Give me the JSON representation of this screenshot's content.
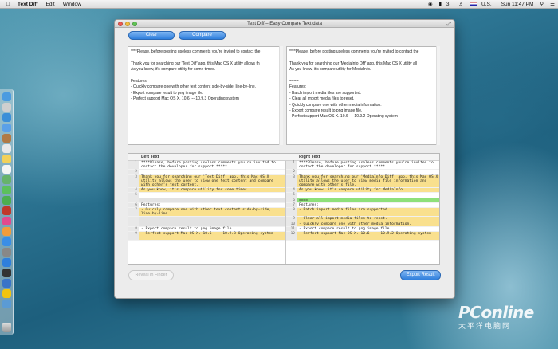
{
  "menubar": {
    "app_name": "Text Diff",
    "items": [
      "Edit",
      "Window"
    ],
    "right": {
      "battery_pct": "3",
      "locale": "U.S.",
      "clock": "Sun 11:47 PM"
    }
  },
  "window": {
    "title": "Text Diff – Easy Compare Text data",
    "buttons": {
      "clear": "Clear",
      "compare": "Compare",
      "reveal": "Reveal in Finder",
      "export": "Export Result"
    },
    "left_text": "****Please, before posting useless comments you're invited to contact the\n\nThank you for searching our 'Text Diff' app, this Mac OS X utility allows th\nAs you know, it's compare utility for some times.\n\nFeatures:\n- Quickly compare one with other text content side-by-side, line-by-line.\n- Export compare result to png image file.\n- Perfect support Mac OS X. 10.6 --- 10.9.3 Operating system",
    "right_text": "****Please, before posting useless comments you're invited to contact the\n\nThank you for searching our 'MediaInfo Diff' app, this Mac OS X utility all\nAs you know, it's compare utility for MediaInfo.\n\n====\nFeatures:\n- Batch import media files are supported.\n- Clear all import media files to reset.\n- Quickly compare one with other media information.\n- Export compare result to png image file.\n- Perfect support Mac OS X. 10.6 --- 10.9.2 Operating system"
  },
  "diff": {
    "left_header": "Left Text",
    "right_header": "Right Text",
    "left": [
      {
        "n": "1",
        "t": "****Please, before posting useless comments you're invited to contact the developer for support.*****",
        "s": "same",
        "h": 2
      },
      {
        "n": "2",
        "t": "",
        "s": "same",
        "h": 1
      },
      {
        "n": "3",
        "t": "Thank you for searching our 'Text Diff' app, this Mac OS X utility allows the user to view one text content and compare with other's text content.",
        "s": "changed",
        "h": 3
      },
      {
        "n": "4",
        "t": "As you know, it's compare utility for some times.",
        "s": "changed",
        "h": 1
      },
      {
        "n": "5",
        "t": "",
        "s": "same",
        "h": 1
      },
      {
        "n": "",
        "t": "",
        "s": "empty",
        "h": 1
      },
      {
        "n": "6",
        "t": "Features:",
        "s": "same",
        "h": 1
      },
      {
        "n": "7",
        "t": "- Quickly compare one with other text content side-by-side, line-by-line.",
        "s": "changed",
        "h": 2
      },
      {
        "n": "",
        "t": "",
        "s": "empty",
        "h": 1
      },
      {
        "n": "",
        "t": "",
        "s": "empty",
        "h": 1
      },
      {
        "n": "8",
        "t": "- Export compare result to png image file.",
        "s": "same",
        "h": 1
      },
      {
        "n": "9",
        "t": "- Perfect support Mac OS X. 10.6 --- 10.9.3 Operating system",
        "s": "changed",
        "h": 2
      }
    ],
    "right": [
      {
        "n": "1",
        "t": "****Please, before posting useless comments you're invited to contact the developer for support.*****",
        "s": "same",
        "h": 2
      },
      {
        "n": "2",
        "t": "",
        "s": "same",
        "h": 1
      },
      {
        "n": "3",
        "t": "Thank you for searching our 'MediaInfo Diff' app, this Mac OS X utility allows the user to view media file information and compare with other's file.",
        "s": "changed",
        "h": 3
      },
      {
        "n": "4",
        "t": "As you know, it's compare utility for MediaInfo.",
        "s": "changed",
        "h": 1
      },
      {
        "n": "5",
        "t": "",
        "s": "same",
        "h": 1
      },
      {
        "n": "6",
        "t": "====",
        "s": "added",
        "h": 1
      },
      {
        "n": "7",
        "t": "Features:",
        "s": "same",
        "h": 1
      },
      {
        "n": "8",
        "t": "- Batch import media files are supported.",
        "s": "changed",
        "h": 2
      },
      {
        "n": "9",
        "t": "- Clear all import media files to reset.",
        "s": "changed",
        "h": 1
      },
      {
        "n": "10",
        "t": "- Quickly compare one with other media information.",
        "s": "changed",
        "h": 1
      },
      {
        "n": "11",
        "t": "- Export compare result to png image file.",
        "s": "same",
        "h": 1
      },
      {
        "n": "12",
        "t": "- Perfect support Mac OS X. 10.6 --- 10.9.2 Operating system",
        "s": "changed",
        "h": 2
      }
    ]
  },
  "watermark": {
    "main": "PConline",
    "sub": "太平洋电脑网"
  },
  "colors": {
    "accent": "#2f7fdc",
    "changed": "#f9e08e",
    "added": "#8ee07a",
    "empty": "#e2e2e2"
  },
  "dock_icons": [
    "finder-icon",
    "launchpad-icon",
    "safari-icon",
    "mail-icon",
    "contacts-icon",
    "calendar-icon",
    "notes-icon",
    "reminders-icon",
    "maps-icon",
    "messages-icon",
    "facetime-icon",
    "photo-booth-icon",
    "itunes-icon",
    "ibooks-icon",
    "app-store-icon",
    "preferences-icon",
    "text-diff-icon",
    "terminal-icon",
    "xcode-icon",
    "photos-icon",
    "downloads-icon",
    "trash-icon"
  ]
}
